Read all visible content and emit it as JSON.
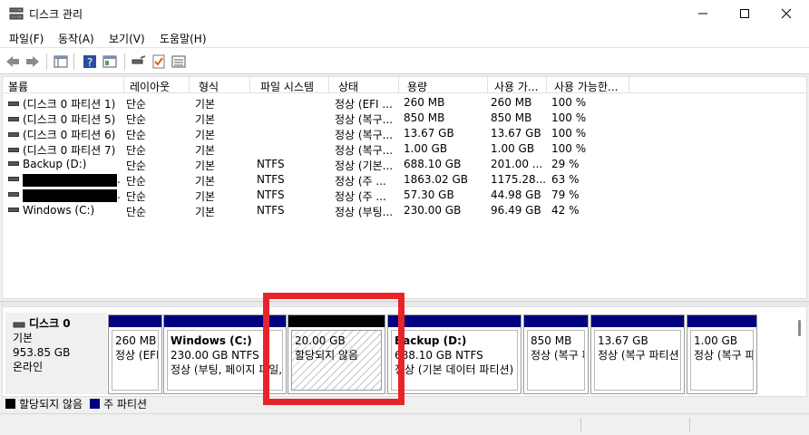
{
  "window": {
    "title": "디스크 관리",
    "minimize_symbol": "—",
    "maximize_symbol": "☐",
    "close_symbol": "✕"
  },
  "menu": [
    {
      "label": "파일(F)"
    },
    {
      "label": "동작(A)"
    },
    {
      "label": "보기(V)"
    },
    {
      "label": "도움말(H)"
    }
  ],
  "toolbar": {
    "icons": [
      "back-arrow-icon",
      "forward-arrow-icon",
      "console-tree-icon",
      "help-icon",
      "properties-icon",
      "rescan-disks-icon",
      "check-icon",
      "list-view-icon"
    ]
  },
  "volume_list": {
    "columns": [
      "볼륨",
      "레이아웃",
      "형식",
      "파일 시스템",
      "상태",
      "용량",
      "사용 가...",
      "사용 가능한..."
    ],
    "rows": [
      {
        "volume": "(디스크 0 파티션 1)",
        "layout": "단순",
        "type": "기본",
        "fs": "",
        "status": "정상 (EFI ...",
        "capacity": "260 MB",
        "free": "260 MB",
        "pct": "100 %",
        "redacted": false
      },
      {
        "volume": "(디스크 0 파티션 5)",
        "layout": "단순",
        "type": "기본",
        "fs": "",
        "status": "정상 (복구...",
        "capacity": "850 MB",
        "free": "850 MB",
        "pct": "100 %",
        "redacted": false
      },
      {
        "volume": "(디스크 0 파티션 6)",
        "layout": "단순",
        "type": "기본",
        "fs": "",
        "status": "정상 (복구...",
        "capacity": "13.67 GB",
        "free": "13.67 GB",
        "pct": "100 %",
        "redacted": false
      },
      {
        "volume": "(디스크 0 파티션 7)",
        "layout": "단순",
        "type": "기본",
        "fs": "",
        "status": "정상 (복구...",
        "capacity": "1.00 GB",
        "free": "1.00 GB",
        "pct": "100 %",
        "redacted": false
      },
      {
        "volume": "Backup (D:)",
        "layout": "단순",
        "type": "기본",
        "fs": "NTFS",
        "status": "정상 (기본...",
        "capacity": "688.10 GB",
        "free": "201.00 ...",
        "pct": "29 %",
        "redacted": false
      },
      {
        "volume": ".",
        "layout": "단순",
        "type": "기본",
        "fs": "NTFS",
        "status": "정상 (주 ...",
        "capacity": "1863.02 GB",
        "free": "1175.28...",
        "pct": "63 %",
        "redacted": true
      },
      {
        "volume": ".",
        "layout": "단순",
        "type": "기본",
        "fs": "NTFS",
        "status": "정상 (주 ...",
        "capacity": "57.30 GB",
        "free": "44.98 GB",
        "pct": "79 %",
        "redacted": true
      },
      {
        "volume": "Windows (C:)",
        "layout": "단순",
        "type": "기본",
        "fs": "NTFS",
        "status": "정상 (부팅...",
        "capacity": "230.00 GB",
        "free": "96.49 GB",
        "pct": "42 %",
        "redacted": false
      }
    ]
  },
  "disk": {
    "name": "디스크 0",
    "kind": "기본",
    "size": "953.85 GB",
    "state": "온라인",
    "partitions": [
      {
        "name": "",
        "line1": "260 MB",
        "line2": "정상 (EFI 시스템 파티션)",
        "band": "#000080",
        "unallocated": false
      },
      {
        "name": "Windows  (C:)",
        "line1": "230.00 GB NTFS",
        "line2": "정상 (부팅, 페이지 파일, 크래시 덤프, 기본 데이터 파티션)",
        "band": "#000080",
        "unallocated": false
      },
      {
        "name": "",
        "line1": "20.00 GB",
        "line2": "할당되지 않음",
        "band": "#000000",
        "unallocated": true
      },
      {
        "name": "Backup  (D:)",
        "line1": "688.10 GB NTFS",
        "line2": "정상 (기본 데이터 파티션)",
        "band": "#000080",
        "unallocated": false
      },
      {
        "name": "",
        "line1": "850 MB",
        "line2": "정상 (복구 파티션)",
        "band": "#000080",
        "unallocated": false
      },
      {
        "name": "",
        "line1": "13.67 GB",
        "line2": "정상 (복구 파티션)",
        "band": "#000080",
        "unallocated": false
      },
      {
        "name": "",
        "line1": "1.00 GB",
        "line2": "정상 (복구 파티션)",
        "band": "#000080",
        "unallocated": false
      }
    ]
  },
  "legend": [
    {
      "label": "할당되지 않음",
      "color": "#000000"
    },
    {
      "label": "주 파티션",
      "color": "#000080"
    }
  ],
  "colors": {
    "primary_partition": "#000080",
    "unallocated": "#000000",
    "highlight": "#e8242a"
  }
}
